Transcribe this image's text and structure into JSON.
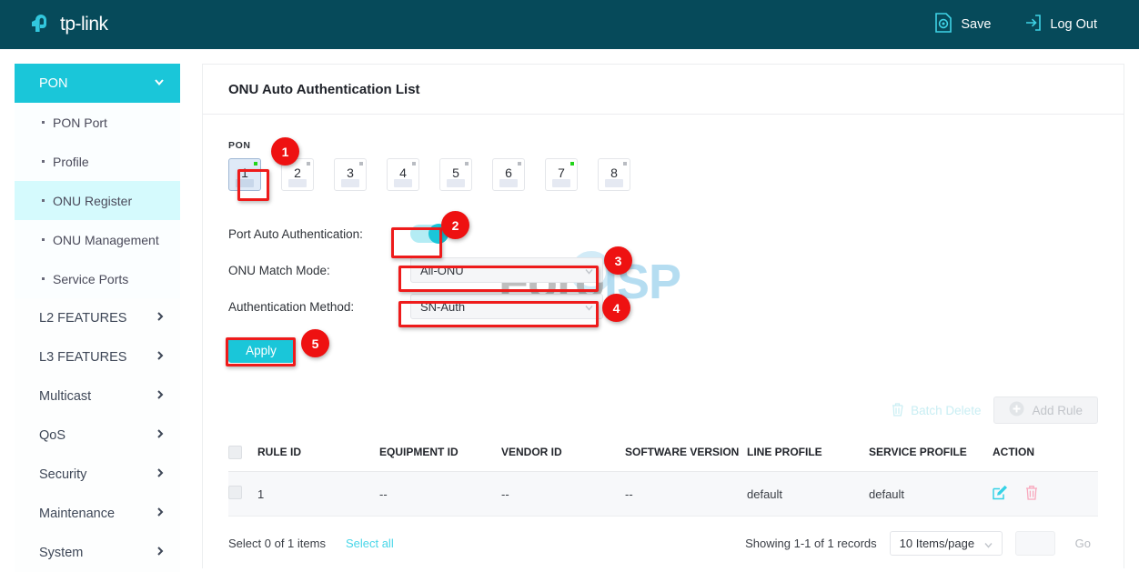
{
  "header": {
    "brand": "tp-link",
    "brand_icon": "tp-link-logo-icon",
    "save_label": "Save",
    "save_icon": "save-gear-icon",
    "logout_label": "Log Out",
    "logout_icon": "logout-arrow-icon"
  },
  "sidebar": {
    "group": {
      "label": "PON",
      "icon": "chevron-down-icon"
    },
    "sub_items": [
      {
        "label": "PON Port",
        "active": false
      },
      {
        "label": "Profile",
        "active": false
      },
      {
        "label": "ONU Register",
        "active": true
      },
      {
        "label": "ONU Management",
        "active": false
      },
      {
        "label": "Service Ports",
        "active": false
      }
    ],
    "items": [
      {
        "label": "L2 FEATURES"
      },
      {
        "label": "L3 FEATURES"
      },
      {
        "label": "Multicast"
      },
      {
        "label": "QoS"
      },
      {
        "label": "Security"
      },
      {
        "label": "Maintenance"
      },
      {
        "label": "System"
      }
    ]
  },
  "watermark": {
    "part1": "Foro",
    "part2": "ISP"
  },
  "main": {
    "title": "ONU Auto Authentication List",
    "pon": {
      "label": "PON",
      "ports": [
        {
          "num": "1",
          "selected": true,
          "led": "on"
        },
        {
          "num": "2",
          "selected": false,
          "led": "off"
        },
        {
          "num": "3",
          "selected": false,
          "led": "off"
        },
        {
          "num": "4",
          "selected": false,
          "led": "off"
        },
        {
          "num": "5",
          "selected": false,
          "led": "off"
        },
        {
          "num": "6",
          "selected": false,
          "led": "off"
        },
        {
          "num": "7",
          "selected": false,
          "led": "on"
        },
        {
          "num": "8",
          "selected": false,
          "led": "off"
        }
      ]
    },
    "form": {
      "auto_auth_label": "Port Auto Authentication:",
      "auto_auth_state": "on",
      "match_mode_label": "ONU Match Mode:",
      "match_mode_value": "All-ONU",
      "auth_method_label": "Authentication Method:",
      "auth_method_value": "SN-Auth",
      "apply_label": "Apply"
    },
    "toolbar": {
      "batch_delete_label": "Batch Delete",
      "batch_delete_icon": "trash-icon",
      "add_rule_label": "Add Rule",
      "add_rule_icon": "plus-circle-icon"
    },
    "table": {
      "columns": [
        "RULE ID",
        "EQUIPMENT ID",
        "VENDOR ID",
        "SOFTWARE VERSION",
        "LINE PROFILE",
        "SERVICE PROFILE",
        "ACTION"
      ],
      "rows": [
        {
          "rule_id": "1",
          "equipment_id": "--",
          "vendor_id": "--",
          "software_version": "--",
          "line_profile": "default",
          "service_profile": "default",
          "edit_icon": "edit-pencil-icon",
          "delete_icon": "trash-icon"
        }
      ]
    },
    "footer": {
      "select_count": "Select 0 of 1 items",
      "select_all": "Select all",
      "showing": "Showing 1-1 of 1 records",
      "page_size": "10 Items/page",
      "page_input_value": "",
      "go_label": "Go"
    }
  },
  "annotations": [
    {
      "n": "1"
    },
    {
      "n": "2"
    },
    {
      "n": "3"
    },
    {
      "n": "4"
    },
    {
      "n": "5"
    }
  ],
  "colors": {
    "brand_dark": "#064a5a",
    "accent_cyan": "#1ac6d9",
    "annotation_red": "#ee1111",
    "led_green": "#23d41a"
  }
}
